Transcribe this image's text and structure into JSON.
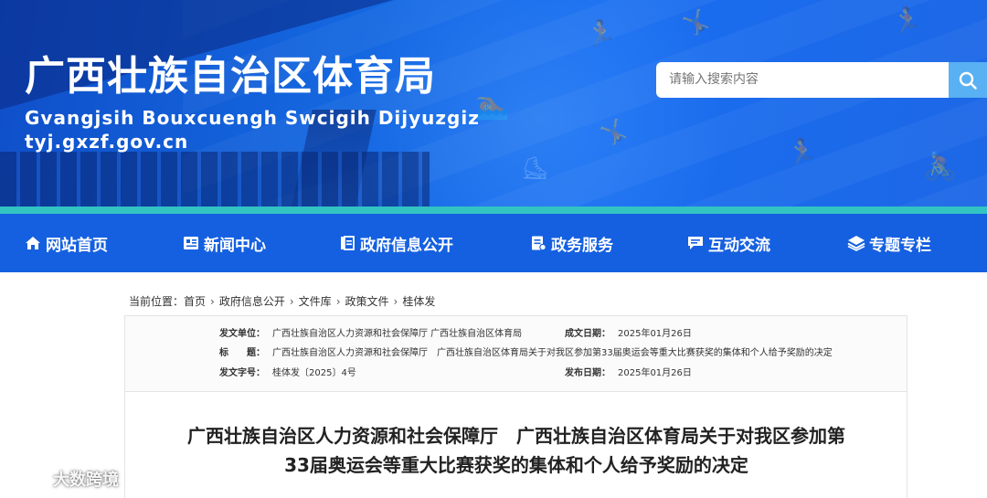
{
  "banner": {
    "title_cn": "广西壮族自治区体育局",
    "title_zhuang": "Gvangjsih Bouxcuengh Swcigih Dijyuzgiz",
    "url": "tyj.gxzf.gov.cn"
  },
  "search": {
    "placeholder": "请输入搜索内容",
    "icon": "search-icon"
  },
  "nav": {
    "items": [
      {
        "label": "网站首页",
        "icon": "home-icon"
      },
      {
        "label": "新闻中心",
        "icon": "newspaper-icon"
      },
      {
        "label": "政府信息公开",
        "icon": "book-icon"
      },
      {
        "label": "政务服务",
        "icon": "document-icon"
      },
      {
        "label": "互动交流",
        "icon": "chat-icon"
      },
      {
        "label": "专题专栏",
        "icon": "layers-icon"
      }
    ],
    "colors": {
      "bar": "#1560e0",
      "stripe": "#32c4c3"
    }
  },
  "breadcrumb": {
    "prefix": "当前位置：",
    "items": [
      "首页",
      "政府信息公开",
      "文件库",
      "政策文件",
      "桂体发"
    ],
    "separator": "›"
  },
  "meta": {
    "issuer_label": "发文单位：",
    "issuer_value": "广西壮族自治区人力资源和社会保障厅 广西壮族自治区体育局",
    "created_label": "成文日期：",
    "created_value": "2025年01月26日",
    "title_label": "标　　题：",
    "title_value": "广西壮族自治区人力资源和社会保障厅　广西壮族自治区体育局关于对我区参加第33届奥运会等重大比赛获奖的集体和个人给予奖励的决定",
    "docno_label": "发文字号：",
    "docno_value": "桂体发〔2025〕4号",
    "published_label": "发布日期：",
    "published_value": "2025年01月26日"
  },
  "document": {
    "title_line1": "广西壮族自治区人力资源和社会保障厅　广西壮族自治区体育局关于对我区参加第",
    "title_line2": "33届奥运会等重大比赛获奖的集体和个人给予奖励的决定"
  },
  "watermark": {
    "text": "大数跨境"
  }
}
